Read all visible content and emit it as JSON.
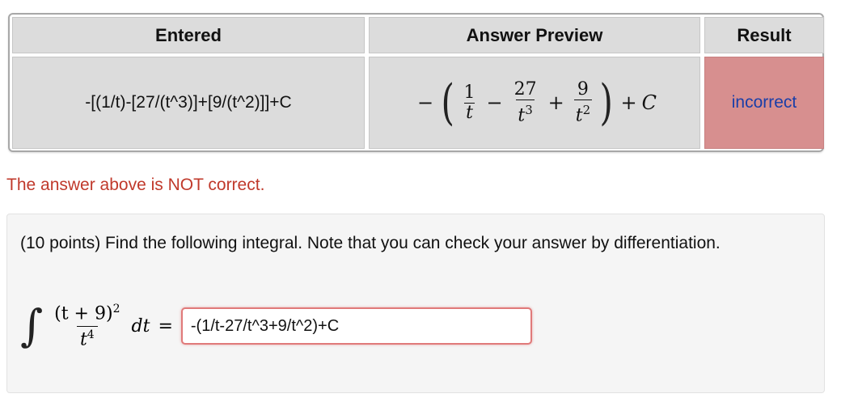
{
  "table": {
    "headers": [
      "Entered",
      "Answer Preview",
      "Result"
    ],
    "entered": "-[(1/t)-[27/(t^3)]+[9/(t^2)]]+C",
    "preview": {
      "minus": "−",
      "lparen": "(",
      "frac1_num": "1",
      "frac1_den": "t",
      "op1": "−",
      "frac2_num": "27",
      "frac2_den": "t",
      "frac2_exp": "3",
      "op2": "+",
      "frac3_num": "9",
      "frac3_den": "t",
      "frac3_exp": "2",
      "rparen": ")",
      "plus": "+",
      "const": "C"
    },
    "result": "incorrect"
  },
  "feedback": "The answer above is NOT correct.",
  "problem": {
    "text": "(10 points) Find the following integral. Note that you can check your answer by differentiation.",
    "integral_sign": "∫",
    "numerator": "(t + 9)",
    "numerator_exp": "2",
    "denominator": "t",
    "denominator_exp": "4",
    "dt": "dt",
    "equals": "=",
    "answer_value": "-(1/t-27/t^3+9/t^2)+C"
  },
  "colors": {
    "incorrect_bg": "#d78f8f",
    "feedback_text": "#c0392b",
    "input_border": "#e07a7a"
  }
}
